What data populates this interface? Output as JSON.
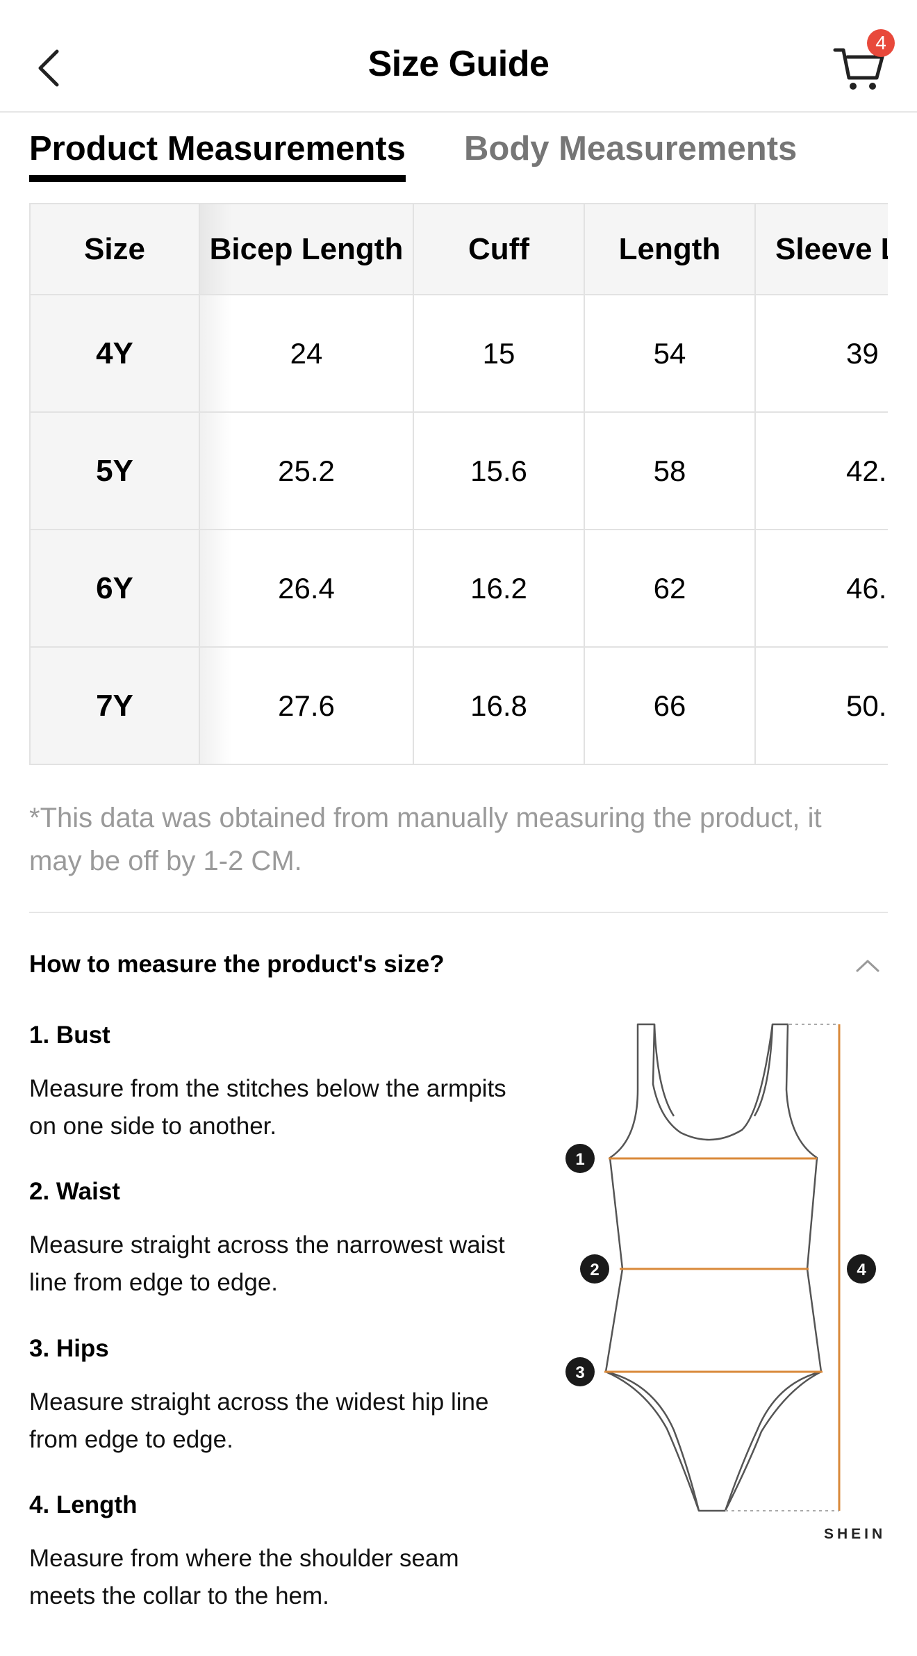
{
  "header": {
    "title": "Size Guide",
    "back_icon": "chevron-left-icon",
    "cart_icon": "cart-icon",
    "cart_badge": "4",
    "badge_color": "#e8493b"
  },
  "tabs": [
    {
      "label": "Product Measurements",
      "active": true
    },
    {
      "label": "Body Measurements",
      "active": false
    }
  ],
  "table": {
    "headers": [
      "Size",
      "Bicep Length",
      "Cuff",
      "Length",
      "Sleeve L"
    ],
    "rows": [
      [
        "4Y",
        "24",
        "15",
        "54",
        "39"
      ],
      [
        "5Y",
        "25.2",
        "15.6",
        "58",
        "42."
      ],
      [
        "6Y",
        "26.4",
        "16.2",
        "62",
        "46."
      ],
      [
        "7Y",
        "27.6",
        "16.8",
        "66",
        "50."
      ]
    ]
  },
  "note": "*This data was obtained from manually measuring the product, it may be off by 1-2 CM.",
  "howto": {
    "title": "How to measure the product's size?",
    "collapse_icon": "chevron-up-icon",
    "steps": [
      {
        "title": "1. Bust",
        "desc": "Measure from the stitches below the armpits on one side to another."
      },
      {
        "title": "2. Waist",
        "desc": "Measure straight across the narrowest waist line from edge to edge."
      },
      {
        "title": "3. Hips",
        "desc": "Measure straight across the widest hip line from edge to edge."
      },
      {
        "title": "4. Length",
        "desc": "Measure from where the shoulder seam meets the collar to the hem."
      }
    ],
    "diagram_markers": [
      "1",
      "2",
      "3",
      "4"
    ],
    "measure_line_color": "#d9893a",
    "brand": "SHEIN"
  }
}
